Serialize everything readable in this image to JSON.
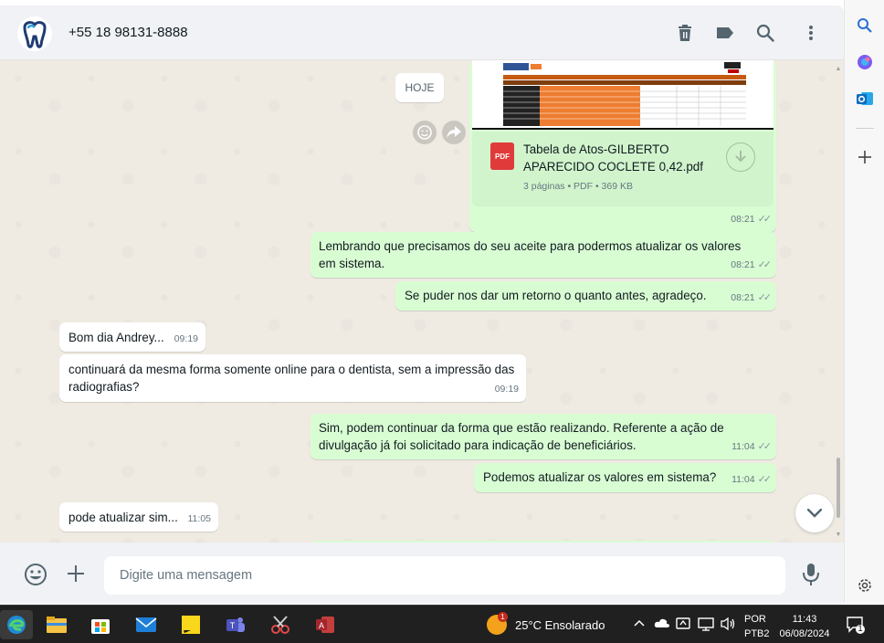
{
  "header": {
    "contact_name": "+55 18 98131-8888"
  },
  "conversation": {
    "date_chip": "HOJE",
    "document": {
      "badge": "PDF",
      "filename": "Tabela de Atos-GILBERTO APARECIDO COCLETE 0,42.pdf",
      "info": "3 páginas • PDF • 369 KB",
      "time": "08:21",
      "ticks": "✓✓"
    },
    "messages": [
      {
        "direction": "out",
        "text": "Lembrando que precisamos do seu aceite para podermos atualizar os valores em sistema.",
        "time": "08:21",
        "ticks": "✓✓"
      },
      {
        "direction": "out",
        "text": "Se puder nos dar um retorno o quanto antes, agradeço.",
        "time": "08:21",
        "ticks": "✓✓"
      },
      {
        "direction": "in",
        "text": "Bom dia Andrey...",
        "time": "09:19"
      },
      {
        "direction": "in",
        "text": "continuará da mesma forma somente online para o dentista, sem a impressão das radiografias?",
        "time": "09:19"
      },
      {
        "direction": "out",
        "text": "Sim, podem continuar da forma que estão realizando. Referente a ação de divulgação já foi solicitado para indicação de beneficiários.",
        "time": "11:04",
        "ticks": "✓✓"
      },
      {
        "direction": "out",
        "text": "Podemos atualizar os valores em sistema?",
        "time": "11:04",
        "ticks": "✓✓"
      },
      {
        "direction": "in",
        "text": "pode atualizar sim...",
        "time": "11:05"
      }
    ]
  },
  "composer": {
    "placeholder": "Digite uma mensagem"
  },
  "taskbar": {
    "weather_badge": "1",
    "weather": "25°C  Ensolarado",
    "lang_line1": "POR",
    "lang_line2": "PTB2",
    "time": "11:43",
    "date": "06/08/2024",
    "notifications": "1"
  }
}
